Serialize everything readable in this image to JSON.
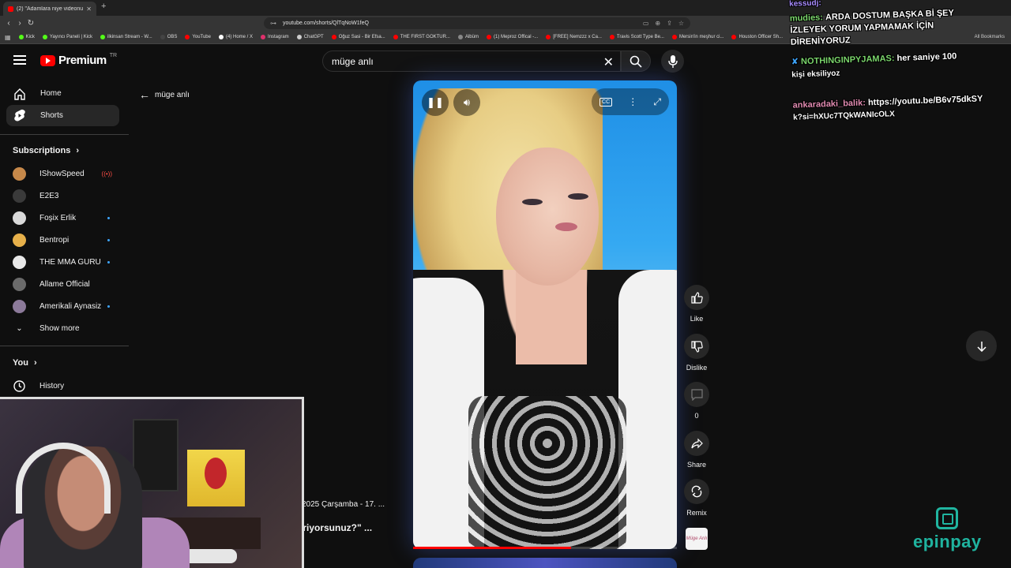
{
  "browser": {
    "tab_title": "(2) \"Adamlara niye videonuzu...",
    "url": "youtube.com/shorts/QlTqNoW1feQ",
    "all_bookmarks": "All Bookmarks",
    "bookmarks": [
      {
        "label": "Kick",
        "color": "#53fc18"
      },
      {
        "label": "Yayıncı Paneli | Kick",
        "color": "#53fc18"
      },
      {
        "label": "ilkinsan Stream - W...",
        "color": "#53fc18"
      },
      {
        "label": "OBS",
        "color": "#444444"
      },
      {
        "label": "YouTube",
        "color": "#ff0000"
      },
      {
        "label": "(4) Home / X",
        "color": "#ffffff"
      },
      {
        "label": "Instagram",
        "color": "#e1306c"
      },
      {
        "label": "ChatGPT",
        "color": "#cccccc"
      },
      {
        "label": "Oğuz Sasi - Bir Efsa...",
        "color": "#ff0000"
      },
      {
        "label": "THE FIRST GOKTUR...",
        "color": "#ff0000"
      },
      {
        "label": "Albüm",
        "color": "#888888"
      },
      {
        "label": "(1) Meproz Offical -...",
        "color": "#ff0000"
      },
      {
        "label": "[FREE] Nemzzz x Ca...",
        "color": "#ff0000"
      },
      {
        "label": "Travis Scott Type Be...",
        "color": "#ff0000"
      },
      {
        "label": "Mersin'in meşhur ci...",
        "color": "#ff0000"
      },
      {
        "label": "Houston Officer Sh...",
        "color": "#ff0000"
      }
    ]
  },
  "header": {
    "logo_text": "Premium",
    "region": "TR",
    "search_value": "müge anlı"
  },
  "sidebar": {
    "items": [
      {
        "label": "Home"
      },
      {
        "label": "Shorts"
      }
    ],
    "subscriptions_title": "Subscriptions",
    "subscriptions": [
      {
        "name": "IShowSpeed",
        "avatar_color": "#c7894a",
        "status": "live"
      },
      {
        "name": "E2E3",
        "avatar_color": "#3a3a3a",
        "status": "none"
      },
      {
        "name": "Foşix Erlik",
        "avatar_color": "#d9d9d9",
        "status": "new"
      },
      {
        "name": "Bentropi",
        "avatar_color": "#e6b04a",
        "status": "new"
      },
      {
        "name": "THE MMA GURU",
        "avatar_color": "#e8e8e8",
        "status": "new"
      },
      {
        "name": "Allame Official",
        "avatar_color": "#6a6a6a",
        "status": "none"
      },
      {
        "name": "Amerikali Aynasiz",
        "avatar_color": "#8c7a9a",
        "status": "new"
      }
    ],
    "show_more": "Show more",
    "you_title": "You",
    "history": "History"
  },
  "page": {
    "back_title": "müge anlı",
    "desc_line1": "2025 Çarşamba - 17. ...",
    "desc_line2": "iriyorsunuz?\" ...",
    "progress": 0.6
  },
  "actions": {
    "like": "Like",
    "dislike": "Dislike",
    "comments": "0",
    "share": "Share",
    "remix": "Remix",
    "channel_thumb": "Müge Anlı"
  },
  "chat": [
    {
      "name": "kessudj:",
      "name_color": "#a98cff",
      "text": ""
    },
    {
      "name": "mudies:",
      "name_color": "#7bd66c",
      "text": "ARDA DOSTUM BAŞKA Bİ ŞEY"
    },
    {
      "name": "",
      "name_color": "#ffffff",
      "text": "İZLEYEK YORUM YAPMAMAK İÇİN"
    },
    {
      "name": "",
      "name_color": "#ffffff",
      "text": "DİRENİYORUZ"
    },
    {
      "name": "NOTHINGINPYJAMAS:",
      "name_color": "#7bd66c",
      "text": "her saniye 100"
    },
    {
      "name": "",
      "name_color": "#ffffff",
      "text": "kişi eksiliyoz"
    },
    {
      "name": "ankaradaki_balik:",
      "name_color": "#e08ab0",
      "text": "https://youtu.be/B6v75dkSY"
    },
    {
      "name": "",
      "name_color": "#ffffff",
      "text": "k?si=hXUc7TQkWANIcOLX"
    }
  ],
  "sponsor": {
    "word": "epinpay"
  }
}
